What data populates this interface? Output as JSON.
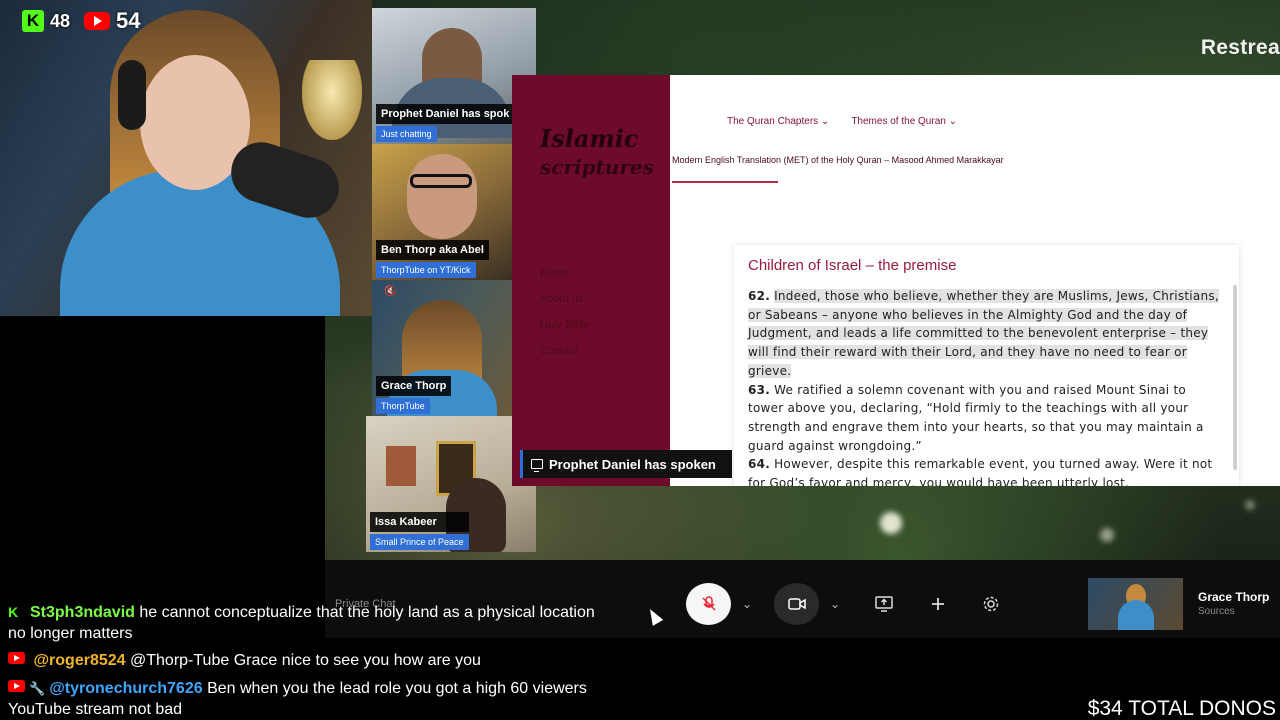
{
  "viewers": {
    "kick_count": "48",
    "youtube_count": "54"
  },
  "overlay": {
    "restream_label": "Restrea"
  },
  "participants": [
    {
      "name": "Prophet Daniel has spok",
      "tag": "Just chatting"
    },
    {
      "name": "Ben Thorp aka Abel",
      "tag": "ThorpTube on YT/Kick"
    },
    {
      "name": "Grace Thorp",
      "tag": "ThorpTube"
    },
    {
      "name": "Issa Kabeer",
      "tag": "Small Prince of Peace"
    }
  ],
  "website": {
    "logo_line1": "Islamic",
    "logo_line2": "scriptures",
    "side_nav": [
      "Home",
      "About us",
      "Holy Bible",
      "Contact"
    ],
    "nav_items": [
      "The Quran Chapters ⌄",
      "Themes of the Quran ⌄"
    ],
    "subtitle": "Modern English Translation (MET) of the Holy Quran – Masood Ahmed Marakkayar",
    "article_title": "Children of Israel – the premise",
    "v62_num": "62.",
    "v62_text": "Indeed, those who believe, whether they are Muslims, Jews, Christians, or Sabeans – anyone who believes in the Almighty God and the day of Judgment, and leads a life committed to the benevolent enterprise – they will find their reward with their Lord, and they have no need to fear or grieve.",
    "v63_num": "63.",
    "v63_text": "We ratified a solemn covenant with you and raised Mount Sinai to tower above you, declaring, “Hold firmly to the teachings with all your strength and engrave them into your hearts, so that you may maintain a guard against wrongdoing.”",
    "v64_num": "64.",
    "v64_text": "However, despite this remarkable event, you turned away. Were it not for God’s favor and mercy, you would have been utterly lost."
  },
  "caption": "Prophet Daniel has spoken",
  "controls": {
    "private_chat": "Private Chat",
    "self_name": "Grace Thorp",
    "self_sub": "Sources"
  },
  "chat": [
    {
      "platform": "kick",
      "user": "St3ph3ndavid",
      "user_color": "#7cfc4a",
      "text": "he cannot conceptualize that the holy land as a physical location",
      "cont": "no longer matters"
    },
    {
      "platform": "youtube",
      "user": "@roger8524",
      "user_color": "#f0b429",
      "text": "@Thorp-Tube Grace nice to see you how are you"
    },
    {
      "platform": "youtube",
      "user": "@tyronechurch7626",
      "user_color": "#3ea6ff",
      "text": "Ben when you the lead role you got a high 60 viewers",
      "cont": "YouTube stream not bad"
    }
  ],
  "donations": "$34 TOTAL DONOS"
}
